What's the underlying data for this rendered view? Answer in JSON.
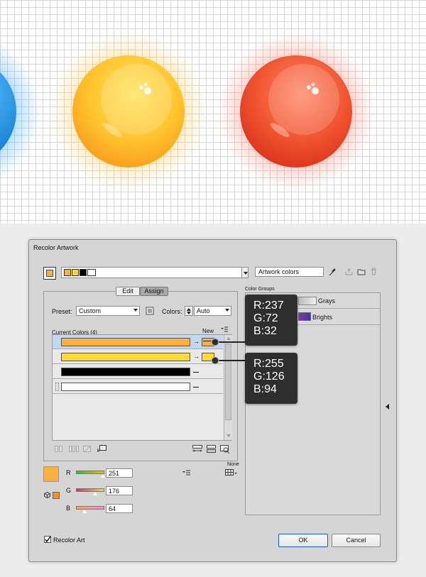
{
  "dialog": {
    "title": "Recolor Artwork",
    "group_name": "Artwork colors",
    "tabs": [
      "Edit",
      "Assign"
    ],
    "preset_label": "Preset:",
    "preset_value": "Custom",
    "colors_label": "Colors:",
    "colors_value": "Auto",
    "current_colors_header": "Current Colors (4)",
    "new_header": "New",
    "color_groups_label": "Color Groups",
    "groups": [
      "Grays",
      "Brights"
    ],
    "rgb": [
      {
        "label": "R",
        "value": "251"
      },
      {
        "label": "G",
        "value": "176"
      },
      {
        "label": "B",
        "value": "64"
      }
    ],
    "none_label": "None",
    "recolor_art_label": "Recolor Art",
    "recolor_art_checked": true,
    "ok_label": "OK",
    "cancel_label": "Cancel"
  },
  "color_rows": [
    {
      "current": "#FBB040",
      "new": "#FBB040"
    },
    {
      "current": "#FFD93A",
      "new": "#FFD93A"
    },
    {
      "current": "#000000",
      "new": ""
    },
    {
      "current": "#FFFFFF",
      "new": ""
    }
  ],
  "callouts": [
    {
      "r": "R:237",
      "g": "G:72",
      "b": "B:32"
    },
    {
      "r": "R:255",
      "g": "G:126",
      "b": "B:94"
    }
  ],
  "colors": {
    "orange_ball": "#F7A226",
    "red_ball": "#E9432A",
    "blue_ball": "#1B8FE0",
    "dialog_bg": "#D5D5D5",
    "selected_row": "#C3D7EE"
  }
}
